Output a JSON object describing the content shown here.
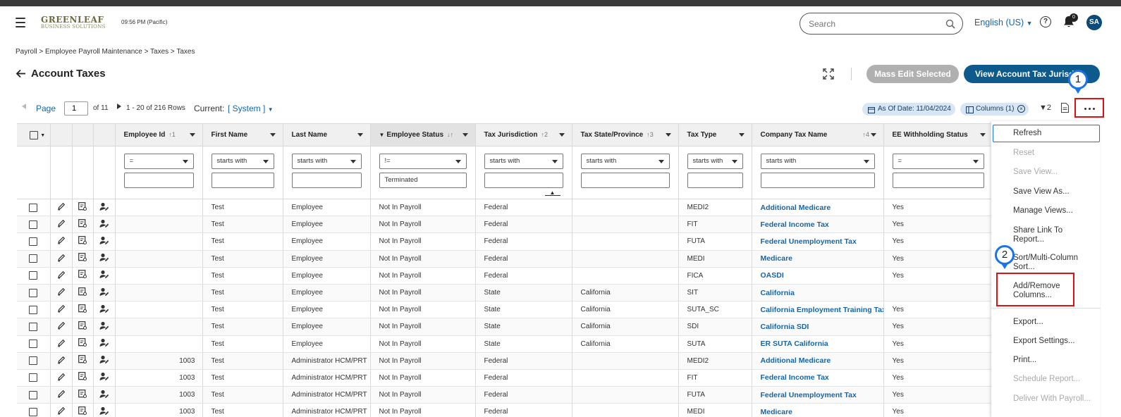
{
  "header": {
    "logo_main": "GREENLEAF",
    "logo_sub": "BUSINESS SOLUTIONS",
    "time": "09:56 PM (Pacific)",
    "search_placeholder": "Search",
    "language": "English (US)",
    "notification_count": "0",
    "avatar_initials": "SA"
  },
  "breadcrumb": "Payroll  >  Employee Payroll Maintenance  >  Taxes  >  Taxes",
  "page_title": "Account Taxes",
  "buttons": {
    "mass_edit": "Mass Edit Selected",
    "view_jurisdiction": "View Account Tax Jurisdi"
  },
  "pager": {
    "page_label": "Page",
    "page_value": "1",
    "of_label": "of 11",
    "rows_label": "1 - 20 of 216 Rows",
    "current_label": "Current:",
    "current_view": "[ System ]"
  },
  "chips": {
    "as_of_date": "As Of Date: 11/04/2024",
    "columns": "Columns (1)"
  },
  "filter_count": "2",
  "columns": [
    {
      "label": "Employee Id",
      "sort": "↑1",
      "op": "=",
      "value": ""
    },
    {
      "label": "First Name",
      "sort": "",
      "op": "starts with",
      "value": ""
    },
    {
      "label": "Last Name",
      "sort": "",
      "op": "starts with",
      "value": ""
    },
    {
      "label": "Employee Status",
      "sort": "↓↑",
      "op": "!=",
      "value": "Terminated"
    },
    {
      "label": "Tax Jurisdiction",
      "sort": "↑2",
      "op": "starts with",
      "value": ""
    },
    {
      "label": "Tax State/Province",
      "sort": "↑3",
      "op": "starts with",
      "value": ""
    },
    {
      "label": "Tax Type",
      "sort": "",
      "op": "starts with",
      "value": ""
    },
    {
      "label": "Company Tax Name",
      "sort": "↑4",
      "op": "starts with",
      "value": ""
    },
    {
      "label": "EE Withholding Status",
      "sort": "",
      "op": "=",
      "value": ""
    }
  ],
  "rows": [
    [
      "",
      "Test",
      "Employee",
      "Not In Payroll",
      "Federal",
      "",
      "MEDI2",
      "Additional Medicare",
      "Yes"
    ],
    [
      "",
      "Test",
      "Employee",
      "Not In Payroll",
      "Federal",
      "",
      "FIT",
      "Federal Income Tax",
      "Yes"
    ],
    [
      "",
      "Test",
      "Employee",
      "Not In Payroll",
      "Federal",
      "",
      "FUTA",
      "Federal Unemployment Tax",
      "Yes"
    ],
    [
      "",
      "Test",
      "Employee",
      "Not In Payroll",
      "Federal",
      "",
      "MEDI",
      "Medicare",
      "Yes"
    ],
    [
      "",
      "Test",
      "Employee",
      "Not In Payroll",
      "Federal",
      "",
      "FICA",
      "OASDI",
      "Yes"
    ],
    [
      "",
      "Test",
      "Employee",
      "Not In Payroll",
      "State",
      "California",
      "SIT",
      "California",
      ""
    ],
    [
      "",
      "Test",
      "Employee",
      "Not In Payroll",
      "State",
      "California",
      "SUTA_SC",
      "California Employment Training Tax",
      "Yes"
    ],
    [
      "",
      "Test",
      "Employee",
      "Not In Payroll",
      "State",
      "California",
      "SDI",
      "California SDI",
      "Yes"
    ],
    [
      "",
      "Test",
      "Employee",
      "Not In Payroll",
      "State",
      "California",
      "SUTA",
      "ER SUTA California",
      "Yes"
    ],
    [
      "1003",
      "Test",
      "Administrator HCM/PRT",
      "Not In Payroll",
      "Federal",
      "",
      "MEDI2",
      "Additional Medicare",
      "Yes"
    ],
    [
      "1003",
      "Test",
      "Administrator HCM/PRT",
      "Not In Payroll",
      "Federal",
      "",
      "FIT",
      "Federal Income Tax",
      "Yes"
    ],
    [
      "1003",
      "Test",
      "Administrator HCM/PRT",
      "Not In Payroll",
      "Federal",
      "",
      "FUTA",
      "Federal Unemployment Tax",
      "Yes"
    ],
    [
      "1003",
      "Test",
      "Administrator HCM/PRT",
      "Not In Payroll",
      "Federal",
      "",
      "MEDI",
      "Medicare",
      "Yes"
    ]
  ],
  "menu": {
    "refresh": "Refresh",
    "reset": "Reset",
    "save_view": "Save View...",
    "save_view_as": "Save View As...",
    "manage_views": "Manage Views...",
    "share_link": "Share Link To Report...",
    "sort_multi": "Sort/Multi-Column Sort...",
    "add_remove_columns": "Add/Remove Columns...",
    "export": "Export...",
    "export_settings": "Export Settings...",
    "print": "Print...",
    "schedule_report": "Schedule Report...",
    "deliver_with_payroll": "Deliver With Payroll..."
  },
  "callouts": {
    "one": "1",
    "two": "2"
  },
  "colors": {
    "accent": "#0d5a8c",
    "link": "#1565a8",
    "highlight": "#dd1111",
    "callout_ring": "#1a73e8"
  }
}
